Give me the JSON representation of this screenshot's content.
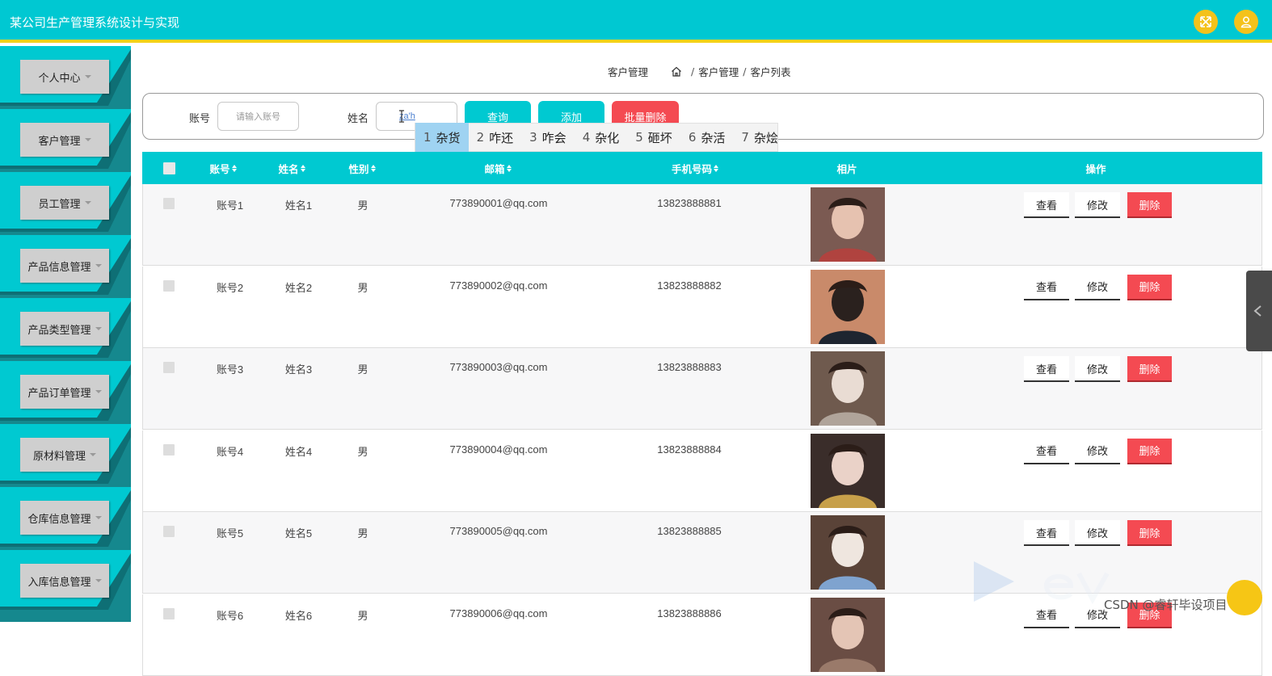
{
  "app": {
    "title": "某公司生产管理系统设计与实现"
  },
  "header": {
    "icons": [
      "fullscreen-icon",
      "user-icon"
    ]
  },
  "sidebar": {
    "items": [
      {
        "label": "个人中心"
      },
      {
        "label": "客户管理"
      },
      {
        "label": "员工管理"
      },
      {
        "label": "产品信息管理"
      },
      {
        "label": "产品类型管理"
      },
      {
        "label": "产品订单管理"
      },
      {
        "label": "原材料管理"
      },
      {
        "label": "仓库信息管理"
      },
      {
        "label": "入库信息管理"
      }
    ]
  },
  "breadcrumb": {
    "section": "客户管理",
    "path": [
      "客户管理",
      "客户列表"
    ]
  },
  "search": {
    "account_label": "账号",
    "account_placeholder": "请输入账号",
    "name_label": "姓名",
    "name_value": "za'h",
    "query_label": "查询",
    "add_label": "添加",
    "batch_delete_label": "批量删除"
  },
  "ime": {
    "candidates": [
      {
        "num": "1",
        "text": "杂货"
      },
      {
        "num": "2",
        "text": "咋还"
      },
      {
        "num": "3",
        "text": "咋会"
      },
      {
        "num": "4",
        "text": "杂化"
      },
      {
        "num": "5",
        "text": "砸坏"
      },
      {
        "num": "6",
        "text": "杂活"
      },
      {
        "num": "7",
        "text": "杂烩"
      }
    ]
  },
  "table": {
    "headers": {
      "account": "账号",
      "name": "姓名",
      "gender": "性别",
      "email": "邮箱",
      "phone": "手机号码",
      "photo": "相片",
      "actions": "操作"
    },
    "action_labels": {
      "view": "查看",
      "edit": "修改",
      "delete": "删除"
    },
    "rows": [
      {
        "account": "账号1",
        "name": "姓名1",
        "gender": "男",
        "email": "773890001@qq.com",
        "phone": "13823888881"
      },
      {
        "account": "账号2",
        "name": "姓名2",
        "gender": "男",
        "email": "773890002@qq.com",
        "phone": "13823888882"
      },
      {
        "account": "账号3",
        "name": "姓名3",
        "gender": "男",
        "email": "773890003@qq.com",
        "phone": "13823888883"
      },
      {
        "account": "账号4",
        "name": "姓名4",
        "gender": "男",
        "email": "773890004@qq.com",
        "phone": "13823888884"
      },
      {
        "account": "账号5",
        "name": "姓名5",
        "gender": "男",
        "email": "773890005@qq.com",
        "phone": "13823888885"
      },
      {
        "account": "账号6",
        "name": "姓名6",
        "gender": "男",
        "email": "773890006@qq.com",
        "phone": "13823888886"
      }
    ]
  },
  "watermark": {
    "text": "CSDN @睿轩毕设项目"
  },
  "colors": {
    "primary": "#00c9d1",
    "accent": "#f7d21a",
    "danger": "#f44a52",
    "sidebar_dark": "#15888e"
  }
}
